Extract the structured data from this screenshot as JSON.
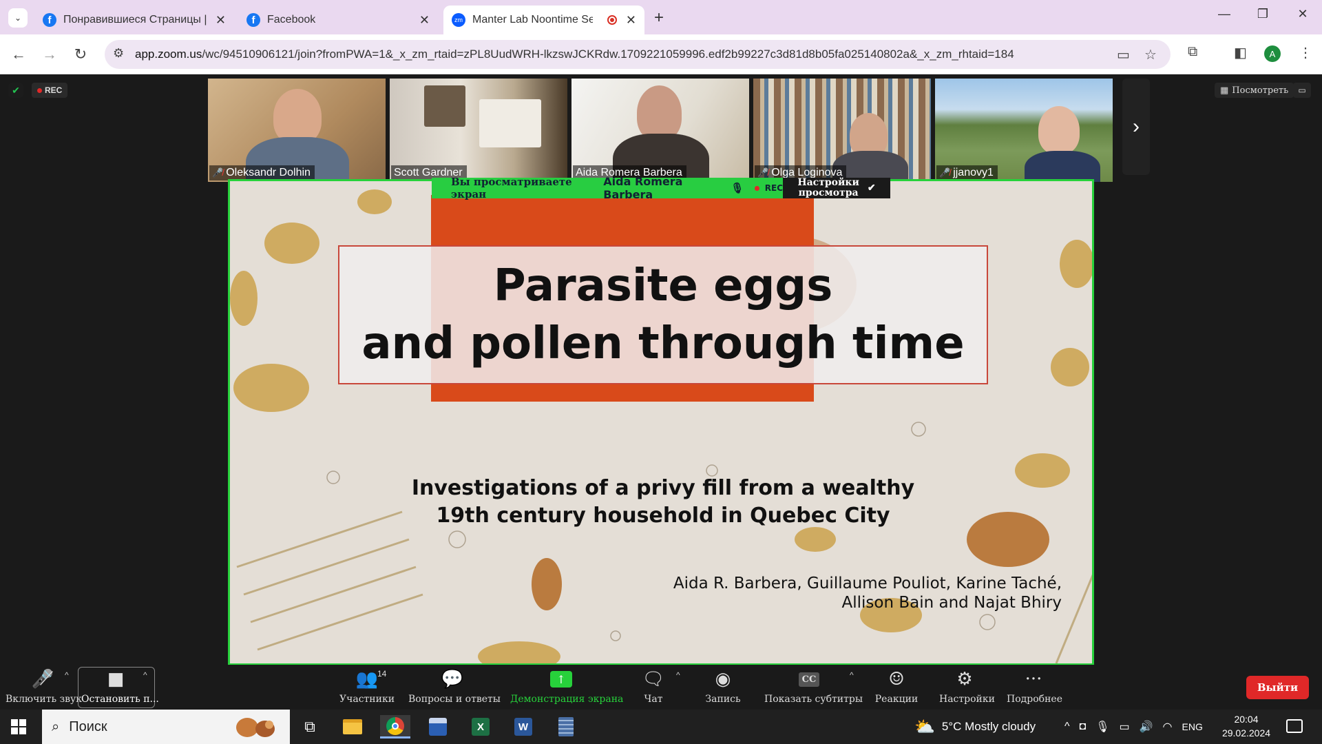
{
  "browser": {
    "tabs": [
      {
        "title": "Понравившиеся Страницы | Fa",
        "icon": "facebook-icon"
      },
      {
        "title": "Facebook",
        "icon": "facebook-icon"
      },
      {
        "title": "Manter Lab Noontime Semi",
        "icon": "zoom-icon",
        "active": true,
        "recording": true
      }
    ],
    "url_host": "app.zoom.us",
    "url_path": "/wc/94510906121/join?fromPWA=1&_x_zm_rtaid=zPL8UudWRH-lkzswJCKRdw.1709221059996.edf2b99227c3d81d8b05fa025140802a&_x_zm_rhtaid=184",
    "profile_initial": "A"
  },
  "zoom": {
    "rec_label": "REC",
    "view_label": "Посмотреть",
    "participants": [
      {
        "name": "Oleksandr Dolhin",
        "muted": true
      },
      {
        "name": "Scott Gardner",
        "muted": false
      },
      {
        "name": "Aida Romera Barbera",
        "muted": false,
        "speaking": true
      },
      {
        "name": "Olga Loginova",
        "muted": true
      },
      {
        "name": "jjanovy1",
        "muted": true
      }
    ],
    "share_banner": {
      "prefix": "Вы просматриваете экран",
      "presenter": "Aida Romera Barbera",
      "rec": "REC",
      "settings_line1": "Настройки",
      "settings_line2": "просмотра"
    },
    "slide": {
      "title_line1": "Parasite eggs",
      "title_line2": "and pollen through time",
      "subtitle_line1": "Investigations of a privy fill from a wealthy",
      "subtitle_line2": "19th century household in Quebec City",
      "authors_line1": "Aida R. Barbera, Guillaume Pouliot, Karine Taché,",
      "authors_line2": "Allison Bain and Najat Bhiry"
    },
    "controls": {
      "unmute": "Включить звук",
      "stop_video": "Остановить п...",
      "participants": "Участники",
      "participants_count": "14",
      "qa": "Вопросы и ответы",
      "share": "Демонстрация экрана",
      "chat": "Чат",
      "record": "Запись",
      "captions": "Показать субтитры",
      "reactions": "Реакции",
      "settings": "Настройки",
      "more": "Подробнее",
      "leave": "Выйти"
    },
    "colors": {
      "share_border": "#27d13b",
      "leave": "#e02828",
      "slide_accent": "#d94a1a"
    }
  },
  "taskbar": {
    "search_placeholder": "Поиск",
    "weather": "5°C  Mostly cloudy",
    "language": "ENG",
    "time": "20:04",
    "date": "29.02.2024"
  }
}
